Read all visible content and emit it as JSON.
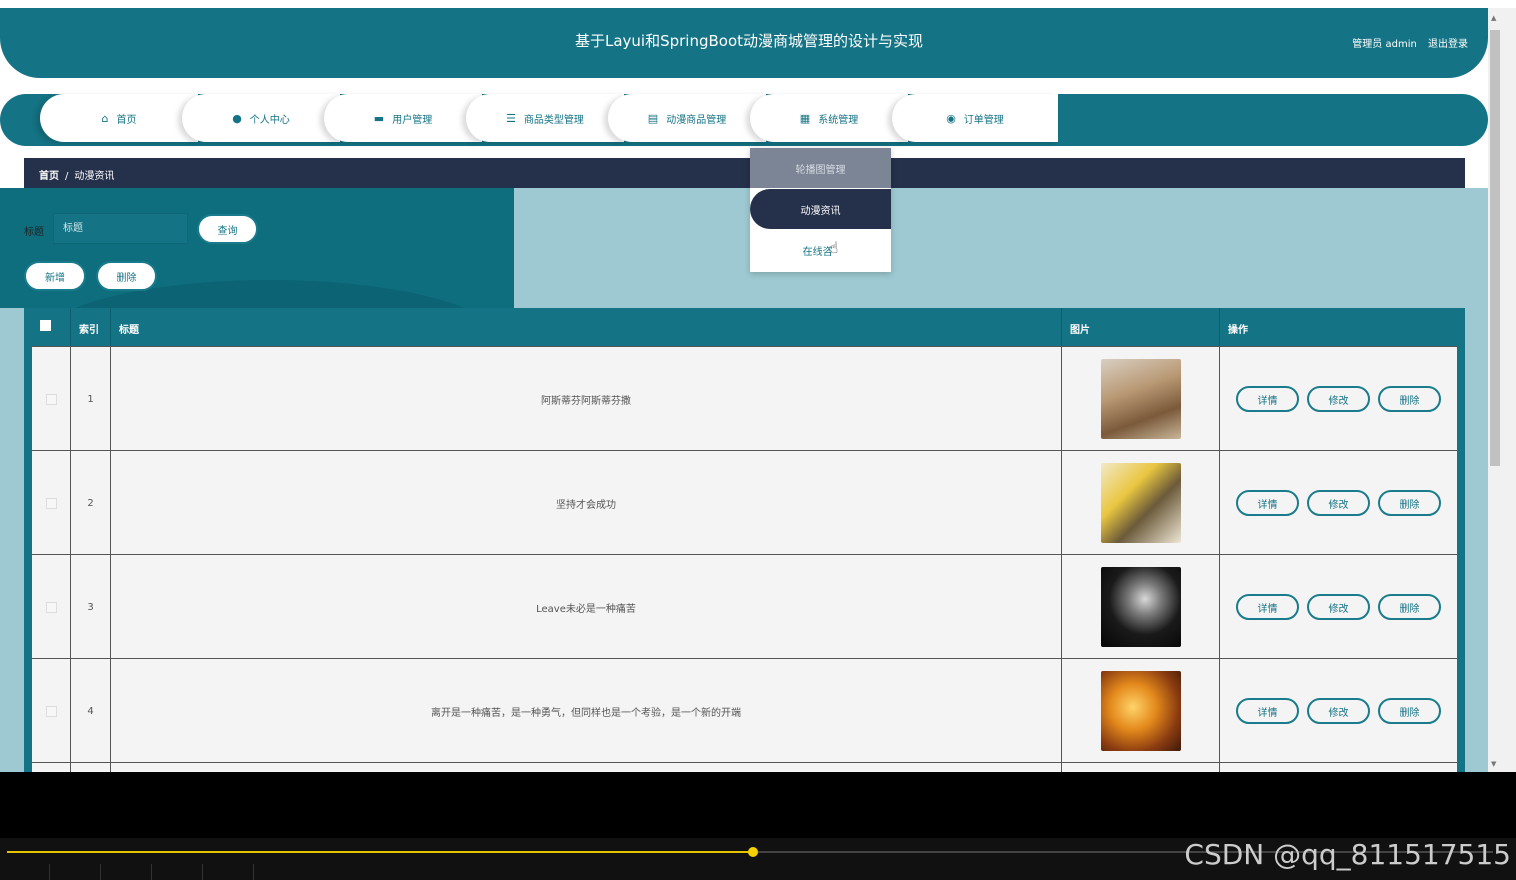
{
  "header": {
    "title": "基于Layui和SpringBoot动漫商城管理的设计与实现",
    "user_label": "管理员 admin",
    "logout_label": "退出登录"
  },
  "nav": {
    "items": [
      {
        "label": "首页",
        "icon": "home-icon"
      },
      {
        "label": "个人中心",
        "icon": "user-icon"
      },
      {
        "label": "用户管理",
        "icon": "monitor-icon"
      },
      {
        "label": "商品类型管理",
        "icon": "sliders-icon"
      },
      {
        "label": "动漫商品管理",
        "icon": "clipboard-icon"
      },
      {
        "label": "系统管理",
        "icon": "grid-icon"
      },
      {
        "label": "订单管理",
        "icon": "location-pin-icon"
      }
    ]
  },
  "breadcrumb": {
    "home": "首页",
    "separator": "/",
    "current": "动漫资讯"
  },
  "dropdown": {
    "items": [
      "轮播图管理",
      "动漫资讯",
      "在线咨"
    ]
  },
  "search": {
    "label": "标题",
    "placeholder": "标题",
    "query_label": "查询",
    "add_label": "新增",
    "delete_label": "删除"
  },
  "table": {
    "columns": [
      "索引",
      "标题",
      "图片",
      "操作"
    ],
    "rows": [
      {
        "index": "1",
        "title": "阿斯蒂芬阿斯蒂芬撒"
      },
      {
        "index": "2",
        "title": "坚持才会成功"
      },
      {
        "index": "3",
        "title": "Leave未必是一种痛苦"
      },
      {
        "index": "4",
        "title": "离开是一种痛苦，是一种勇气，但同样也是一个考验，是一个新的开端"
      }
    ],
    "actions": {
      "detail": "详情",
      "edit": "修改",
      "delete": "删除"
    }
  },
  "watermark": "CSDN @qq_811517515",
  "colors": {
    "primary": "#147384",
    "breadcrumb": "#25304a",
    "content_bg": "#9ec9d2",
    "progress": "#e6c300"
  }
}
